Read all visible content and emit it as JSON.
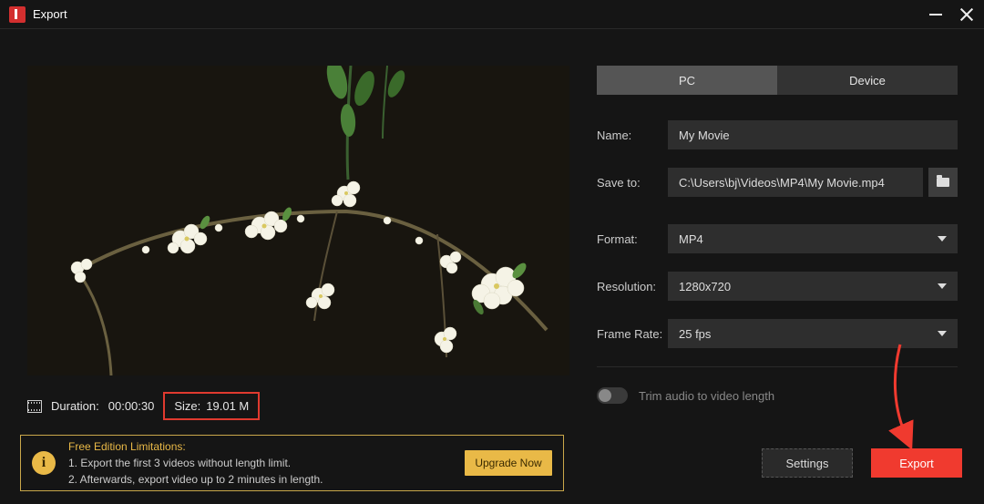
{
  "window": {
    "title": "Export"
  },
  "tabs": {
    "pc": "PC",
    "device": "Device",
    "active": "pc"
  },
  "form": {
    "name_label": "Name:",
    "name_value": "My Movie",
    "saveto_label": "Save to:",
    "saveto_value": "C:\\Users\\bj\\Videos\\MP4\\My Movie.mp4",
    "format_label": "Format:",
    "format_value": "MP4",
    "resolution_label": "Resolution:",
    "resolution_value": "1280x720",
    "framerate_label": "Frame Rate:",
    "framerate_value": "25 fps",
    "trim_label": "Trim audio to video length"
  },
  "info": {
    "duration_label": "Duration:",
    "duration_value": "00:00:30",
    "size_label": "Size:",
    "size_value": "19.01 M"
  },
  "limits": {
    "title": "Free Edition Limitations:",
    "line1": "1. Export the first 3 videos without length limit.",
    "line2": "2. Afterwards, export video up to 2 minutes in length.",
    "upgrade": "Upgrade Now"
  },
  "buttons": {
    "settings": "Settings",
    "export": "Export"
  },
  "info_icon_glyph": "i"
}
